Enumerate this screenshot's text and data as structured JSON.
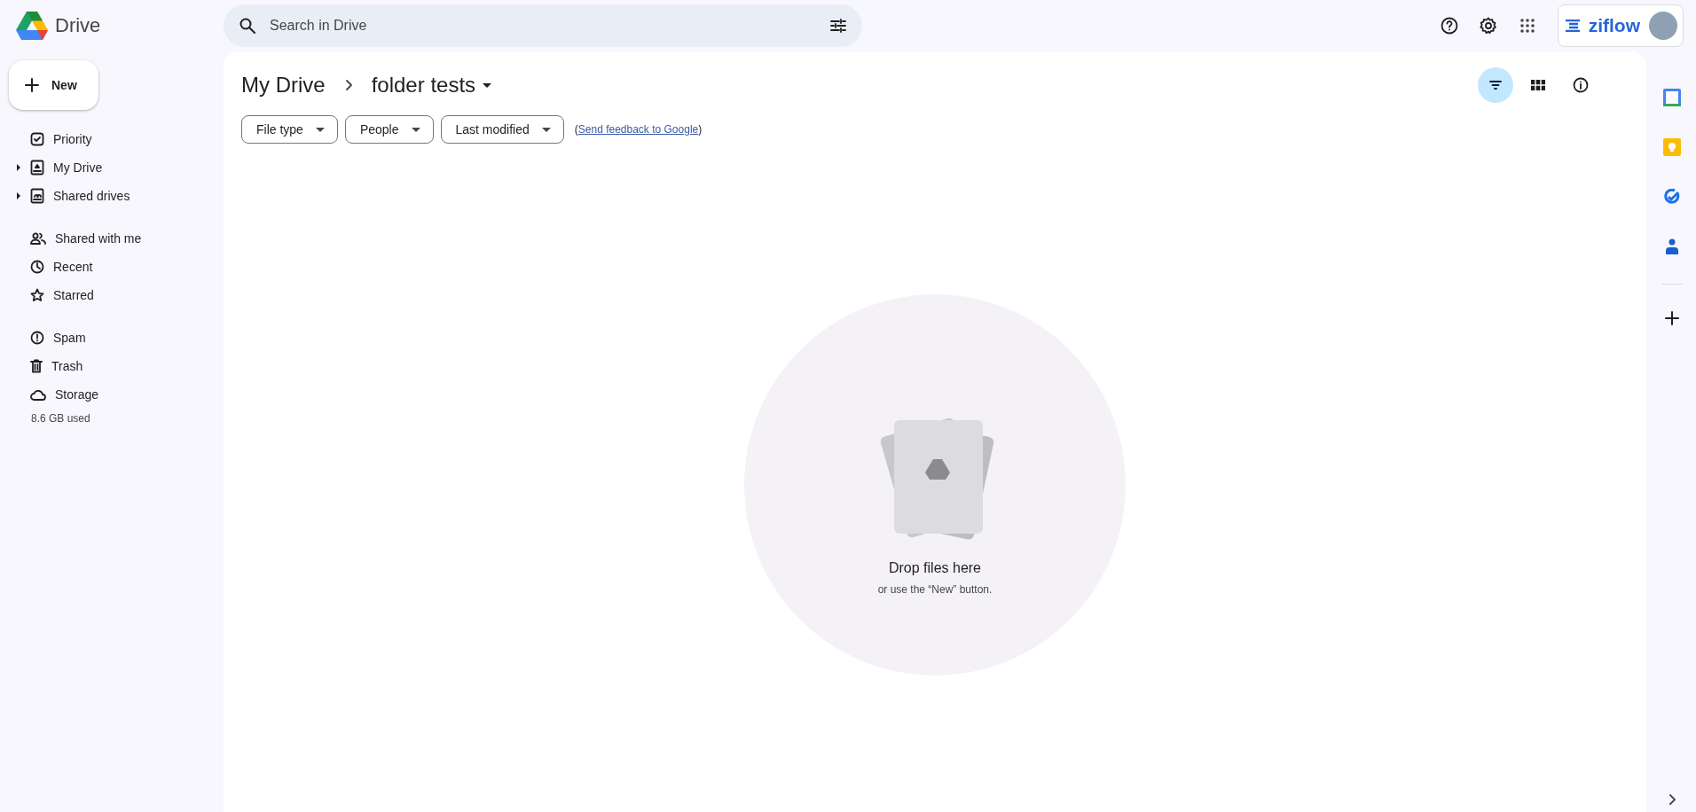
{
  "header": {
    "app_name": "Drive",
    "search": {
      "placeholder": "Search in Drive"
    },
    "extension": {
      "label": "ziflow"
    }
  },
  "new_button": {
    "label": "New"
  },
  "sidebar": {
    "groups": [
      {
        "items": [
          {
            "label": "Priority",
            "expandable": false
          },
          {
            "label": "My Drive",
            "expandable": true
          },
          {
            "label": "Shared drives",
            "expandable": true
          }
        ]
      },
      {
        "items": [
          {
            "label": "Shared with me",
            "expandable": false
          },
          {
            "label": "Recent",
            "expandable": false
          },
          {
            "label": "Starred",
            "expandable": false
          }
        ]
      },
      {
        "items": [
          {
            "label": "Spam",
            "expandable": false
          },
          {
            "label": "Trash",
            "expandable": false
          },
          {
            "label": "Storage",
            "expandable": false
          }
        ]
      }
    ],
    "storage_used": "8.6 GB used"
  },
  "breadcrumb": [
    "My Drive",
    "folder tests"
  ],
  "view_buttons": [
    {
      "selected": true
    },
    {
      "selected": false
    },
    {
      "selected": false
    }
  ],
  "filters": [
    {
      "label": "File type"
    },
    {
      "label": "People"
    },
    {
      "label": "Last modified"
    }
  ],
  "feedback": {
    "open": "(",
    "link": "Send feedback to Google",
    "close": ")"
  },
  "empty_state": {
    "title": "Drop files here",
    "subtitle": "or use the “New” button."
  }
}
